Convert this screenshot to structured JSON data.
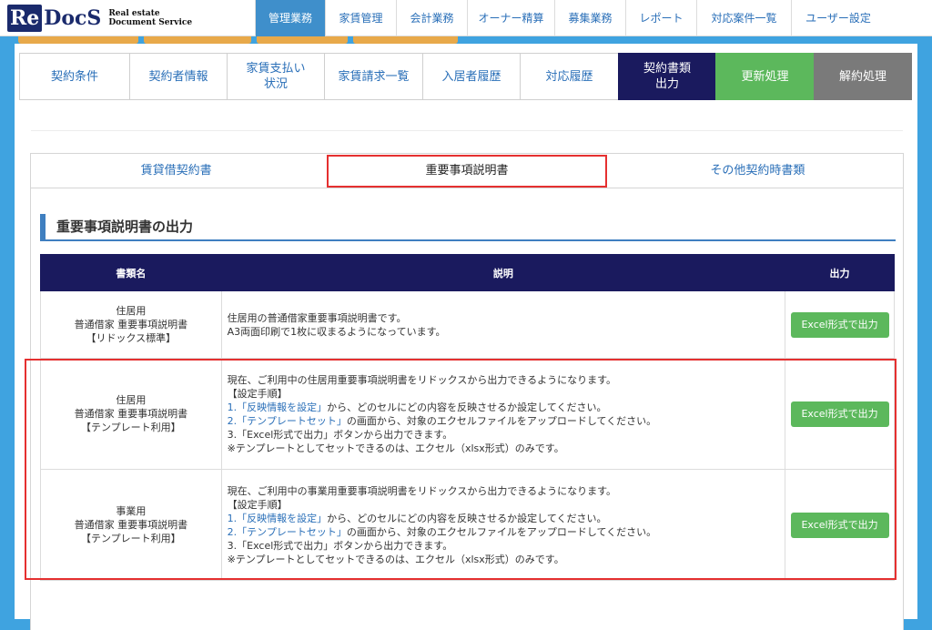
{
  "logo": {
    "re": "Re",
    "docs": "DocS",
    "sub1": "Real estate",
    "sub2": "Document Service"
  },
  "topnav": [
    {
      "label": "管理業務",
      "active": true
    },
    {
      "label": "家賃管理"
    },
    {
      "label": "会計業務"
    },
    {
      "label": "オーナー精算"
    },
    {
      "label": "募集業務"
    },
    {
      "label": "レポート"
    },
    {
      "label": "対応案件一覧"
    },
    {
      "label": "ユーザー設定"
    }
  ],
  "contract_tabs": [
    {
      "label": "契約条件"
    },
    {
      "label": "契約者情報"
    },
    {
      "label": "家賃支払い\n状況"
    },
    {
      "label": "家賃請求一覧"
    },
    {
      "label": "入居者履歴"
    },
    {
      "label": "対応履歴"
    },
    {
      "label": "契約書類\n出力"
    },
    {
      "label": "更新処理"
    },
    {
      "label": "解約処理"
    }
  ],
  "doc_tabs": [
    {
      "label": "賃貸借契約書"
    },
    {
      "label": "重要事項説明書"
    },
    {
      "label": "その他契約時書類"
    }
  ],
  "section_title": "重要事項説明書の出力",
  "table": {
    "headers": {
      "name": "書類名",
      "desc": "説明",
      "out": "出力"
    },
    "button_label": "Excel形式で出力",
    "rows": [
      {
        "name": [
          "住居用",
          "普通借家 重要事項説明書",
          "【リドックス標準】"
        ],
        "desc": [
          "住居用の普通借家重要事項説明書です。",
          "A3両面印刷で1枚に収まるようになっています。"
        ]
      },
      {
        "name": [
          "住居用",
          "普通借家 重要事項説明書",
          "【テンプレート利用】"
        ],
        "desc": [
          "現在、ご利用中の住居用重要事項説明書をリドックスから出力できるようになります。",
          "【設定手順】",
          "から、どのセルにどの内容を反映させるか設定してください。",
          "の画面から、対象のエクセルファイルをアップロードしてください。",
          "3.「Excel形式で出力」ボタンから出力できます。",
          "※テンプレートとしてセットできるのは、エクセル（xlsx形式）のみです。"
        ]
      },
      {
        "name": [
          "事業用",
          "普通借家 重要事項説明書",
          "【テンプレート利用】"
        ],
        "desc": [
          "現在、ご利用中の事業用重要事項説明書をリドックスから出力できるようになります。",
          "【設定手順】",
          "から、どのセルにどの内容を反映させるか設定してください。",
          "の画面から、対象のエクセルファイルをアップロードしてください。",
          "3.「Excel形式で出力」ボタンから出力できます。",
          "※テンプレートとしてセットできるのは、エクセル（xlsx形式）のみです。"
        ]
      }
    ],
    "step1_prefix": "1.",
    "step1_link": "「反映情報を設定」",
    "step2_prefix": "2.",
    "step2_link": "「テンプレートセット」"
  },
  "colors": {
    "navy": "#1a1a5e",
    "green": "#5cb85c",
    "grey": "#7a7a7a",
    "accent_blue": "#3f8fcb",
    "highlight": "#e53030"
  }
}
